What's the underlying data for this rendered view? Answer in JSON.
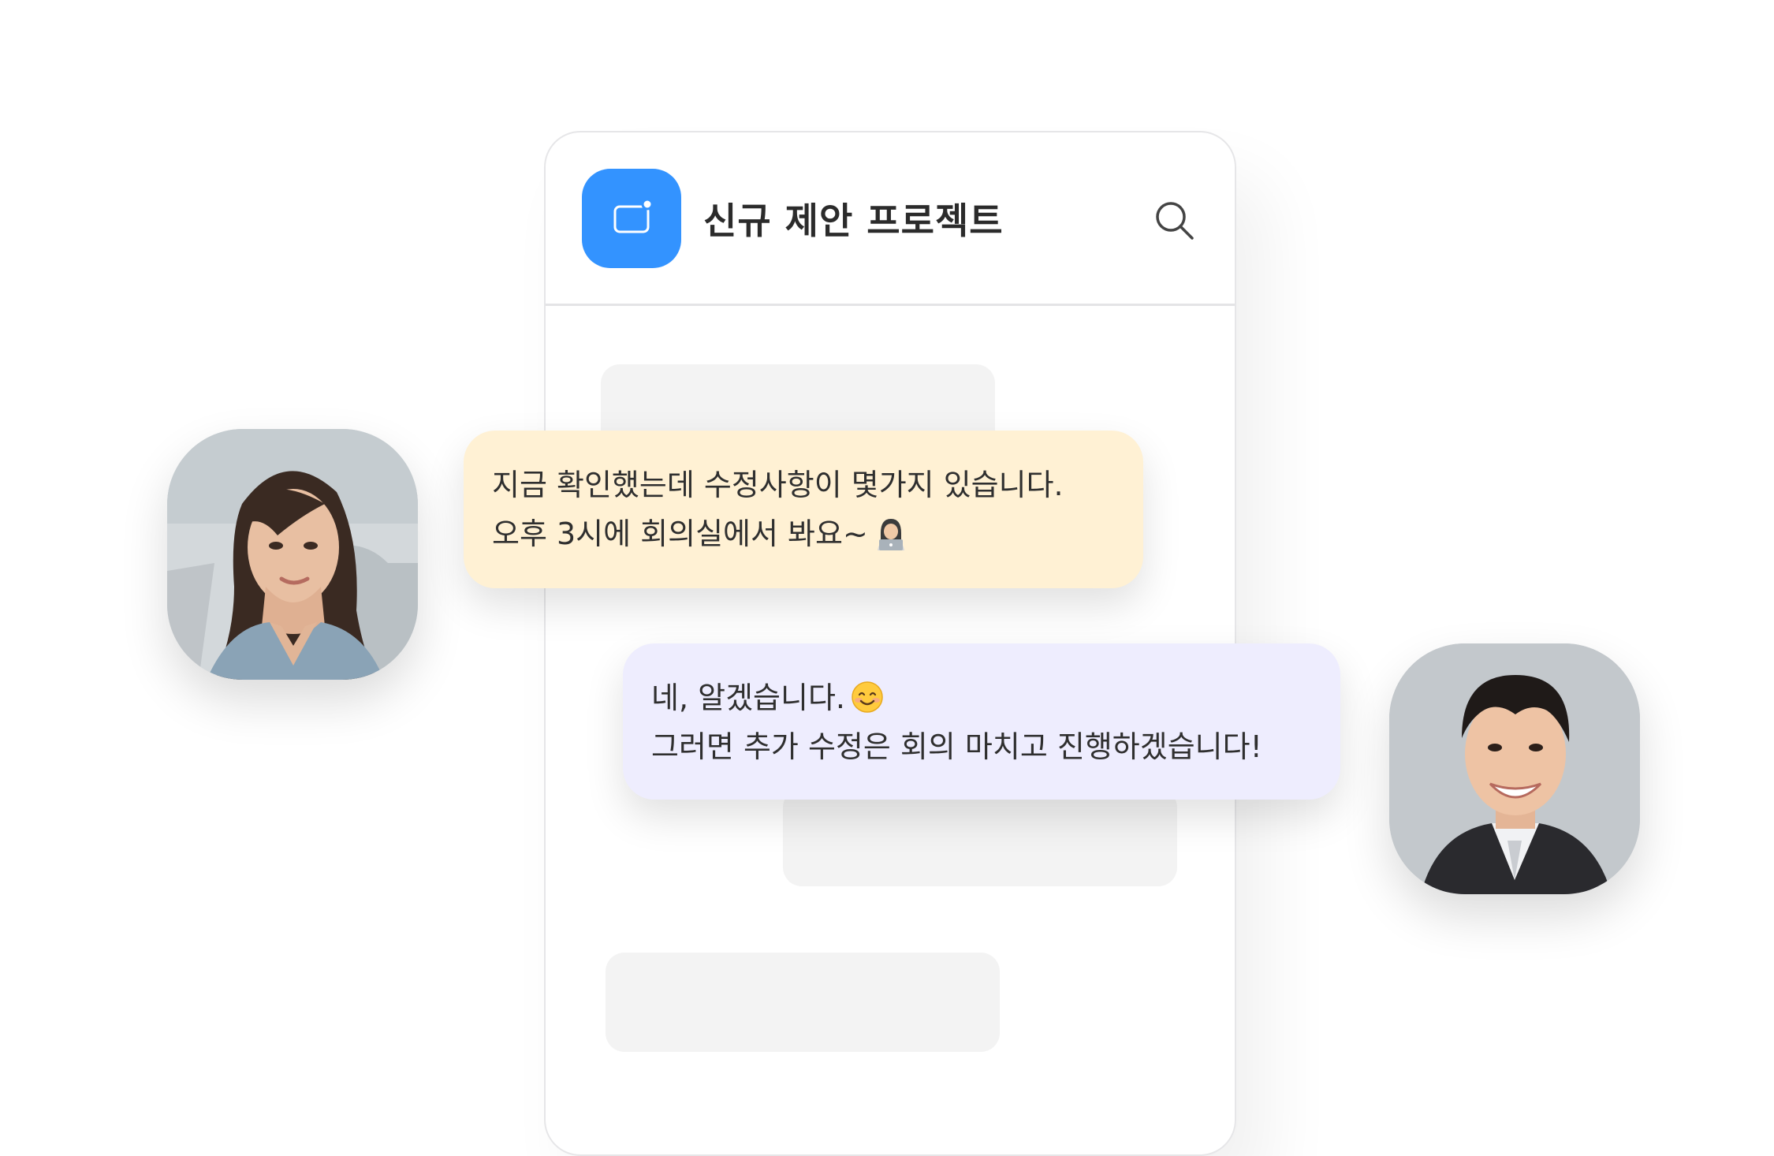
{
  "header": {
    "title": "신규 제안 프로젝트",
    "app_icon": "chat-app-icon",
    "search_icon": "search-icon"
  },
  "messages": [
    {
      "sender": "woman",
      "line1": "지금 확인했는데 수정사항이 몇가지 있습니다.",
      "line2": "오후 3시에 회의실에서 봐요~",
      "emoji": "person-with-laptop-emoji",
      "bubble_color": "#fff1d4"
    },
    {
      "sender": "man",
      "line1": "네, 알겠습니다.",
      "line2": "그러면 추가 수정은 회의 마치고 진행하겠습니다!",
      "emoji": "smiling-face-emoji",
      "bubble_color": "#eeedfe"
    }
  ],
  "colors": {
    "accent": "#3393ff",
    "placeholder": "#f3f3f3",
    "text": "#2f2f2f"
  }
}
